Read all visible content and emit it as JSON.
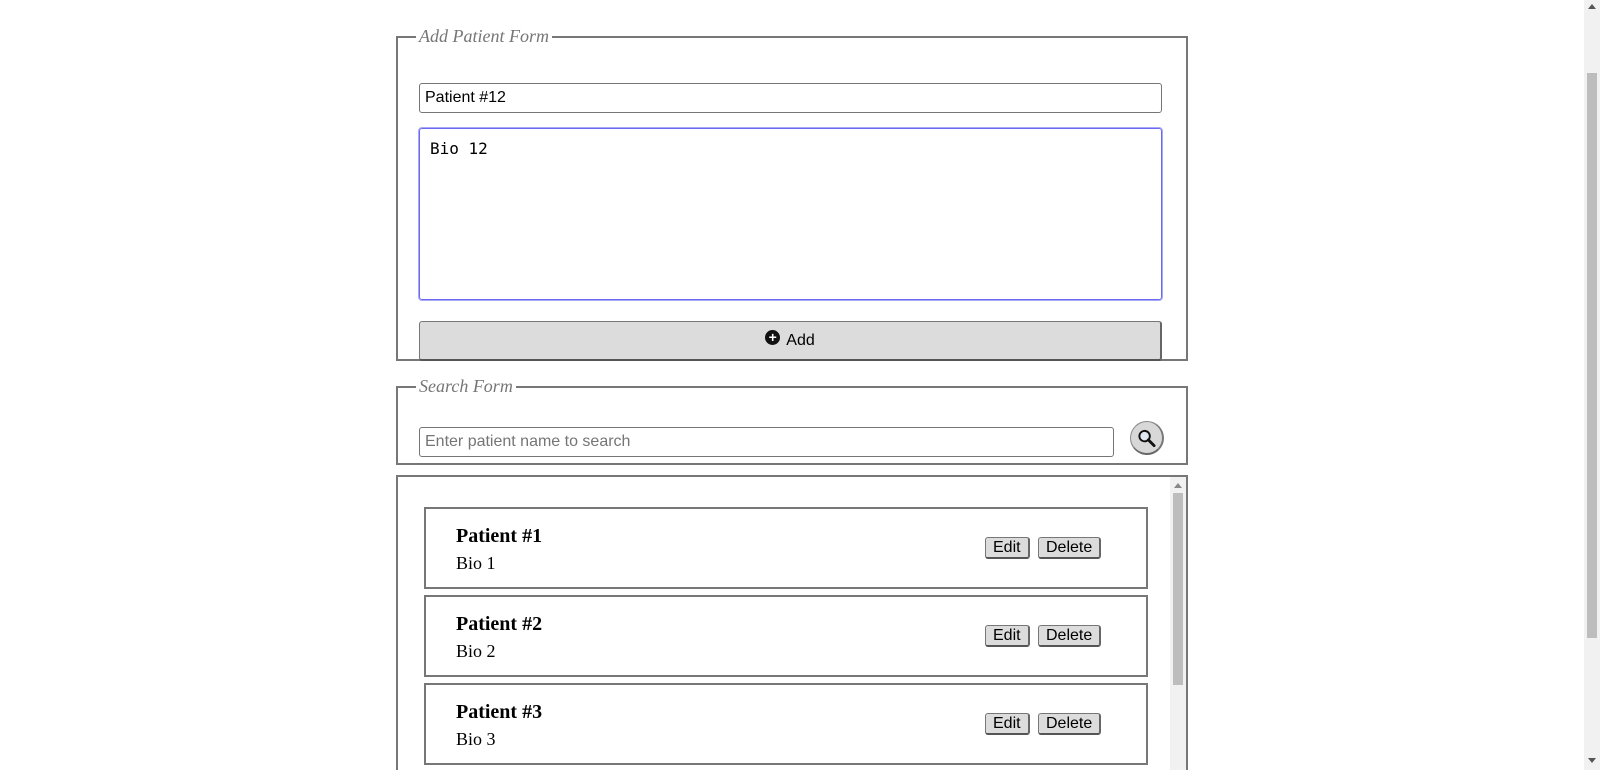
{
  "add_form": {
    "legend": "Add Patient Form",
    "name_value": "Patient #12",
    "bio_value": "Bio 12",
    "add_label": "Add",
    "add_icon": "plus-circle-icon"
  },
  "search_form": {
    "legend": "Search Form",
    "placeholder": "Enter patient name to search",
    "value": "",
    "search_icon": "magnifier-icon"
  },
  "patients": [
    {
      "name": "Patient #1",
      "bio": "Bio 1",
      "edit_label": "Edit",
      "delete_label": "Delete"
    },
    {
      "name": "Patient #2",
      "bio": "Bio 2",
      "edit_label": "Edit",
      "delete_label": "Delete"
    },
    {
      "name": "Patient #3",
      "bio": "Bio 3",
      "edit_label": "Edit",
      "delete_label": "Delete"
    }
  ]
}
